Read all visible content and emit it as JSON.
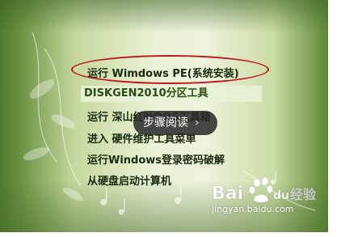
{
  "menu": {
    "items": [
      "运行 Wimdows PE(系统安装)",
      "DISKGEN2010分区工具",
      "运行 深山红叶DOS工具箱",
      "进入 硬件维护工具菜单",
      "运行Windows登录密码破解",
      "从硬盘启动计算机"
    ],
    "selected_index": 1
  },
  "tooltip": {
    "label": "步骤阅读"
  },
  "watermark": {
    "logo_text": "Bai du 经验",
    "url": "jingyan.baidu.com"
  },
  "colors": {
    "background_light": "#eef3dc",
    "background_dark": "#4f7a2e",
    "menu_text": "#1a2a0e",
    "selected_bg": "#e8f2d6",
    "annotation_oval": "#c0171d",
    "tooltip_bg": "#282828"
  }
}
